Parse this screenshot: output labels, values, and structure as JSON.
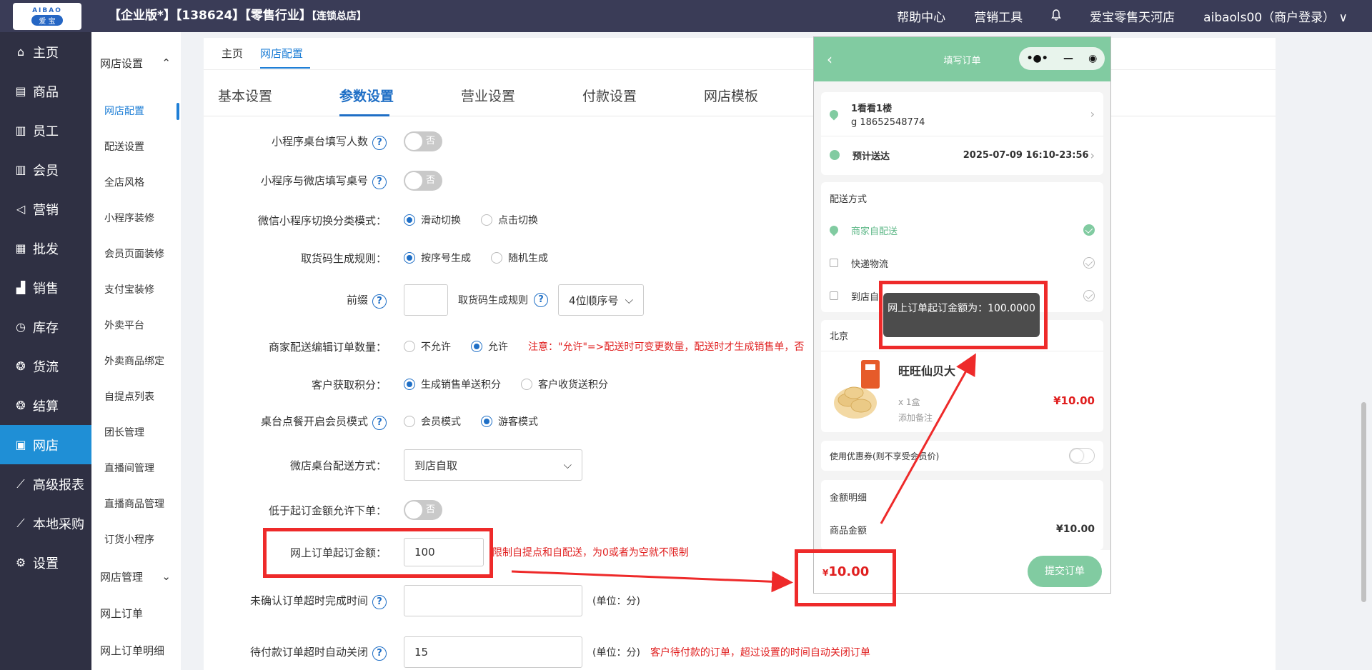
{
  "header": {
    "logo_top": "AIBAO",
    "logo_bottom": "爱 宝",
    "company": "【企业版*】【138624】【零售行业】",
    "company_small": "【连锁总店】",
    "nav": [
      "帮助中心",
      "营销工具"
    ],
    "store": "爱宝零售天河店",
    "user": "aibaols00（商户登录）",
    "chevron": "∨"
  },
  "sidebar": {
    "items": [
      {
        "icon": "⌂",
        "label": "主页"
      },
      {
        "icon": "▤",
        "label": "商品"
      },
      {
        "icon": "▥",
        "label": "员工"
      },
      {
        "icon": "▥",
        "label": "会员"
      },
      {
        "icon": "◁",
        "label": "营销"
      },
      {
        "icon": "▦",
        "label": "批发"
      },
      {
        "icon": "▟",
        "label": "销售"
      },
      {
        "icon": "◷",
        "label": "库存"
      },
      {
        "icon": "❂",
        "label": "货流"
      },
      {
        "icon": "❂",
        "label": "结算"
      },
      {
        "icon": "▣",
        "label": "网店"
      },
      {
        "icon": "⟋",
        "label": "高级报表"
      },
      {
        "icon": "⟋",
        "label": "本地采购"
      },
      {
        "icon": "⚙",
        "label": "设置"
      }
    ]
  },
  "submenu": {
    "group1": "网店设置",
    "group1_arrow": "⌃",
    "items": [
      "网店配置",
      "配送设置",
      "全店风格",
      "小程序装修",
      "会员页面装修",
      "支付宝装修",
      "外卖平台",
      "外卖商品绑定",
      "自提点列表",
      "团长管理",
      "直播间管理",
      "直播商品管理",
      "订货小程序"
    ],
    "group2": "网店管理",
    "group2_arrow": "⌄",
    "plain": [
      "网上订单",
      "网上订单明细"
    ]
  },
  "tabs1": [
    "主页",
    "网店配置"
  ],
  "tabs2": [
    "基本设置",
    "参数设置",
    "营业设置",
    "付款设置",
    "网店模板"
  ],
  "form": {
    "r1_label": "小程序桌台填写人数",
    "toggle_off": "否",
    "r2_label": "小程序与微店填写桌号",
    "r3_label": "微信小程序切换分类模式：",
    "r3_opt1": "滑动切换",
    "r3_opt2": "点击切换",
    "r4_label": "取货码生成规则：",
    "r4_opt1": "按序号生成",
    "r4_opt2": "随机生成",
    "r5_label": "前缀",
    "r5_label2": "取货码生成规则",
    "r5_select": "4位顺序号",
    "r6_label": "商家配送编辑订单数量：",
    "r6_opt1": "不允许",
    "r6_opt2": "允许",
    "r6_note": "注意：\"允许\"=>配送时可变更数量，配送时才生成销售单，否",
    "r7_label": "客户获取积分：",
    "r7_opt1": "生成销售单送积分",
    "r7_opt2": "客户收货送积分",
    "r8_label": "桌台点餐开启会员模式",
    "r8_opt1": "会员模式",
    "r8_opt2": "游客模式",
    "r9_label": "微店桌台配送方式：",
    "r9_select": "到店自取",
    "r10_label": "低于起订金额允许下单：",
    "r11_label": "网上订单起订金额：",
    "r11_value": "100",
    "r11_note": "限制自提点和自配送，为0或者为空就不限制",
    "r12_label": "未确认订单超时完成时间",
    "r12_unit": "(单位：分)",
    "r13_label": "待付款订单超时自动关闭",
    "r13_value": "15",
    "r13_unit": "(单位：分)",
    "r13_note": "客户待付款的订单，超过设置的时间自动关闭订单"
  },
  "phone": {
    "title": "填写订单",
    "caps": [
      "•●•",
      "—",
      "◉"
    ],
    "address_name": "1看看1楼",
    "address_phone": "g 18652548774",
    "eta_label": "预计送达",
    "eta_value": "2025-07-09 16:10-23:56",
    "delivery_title": "配送方式",
    "delivery_opts": [
      "商家自配送",
      "快递物流",
      "到店自"
    ],
    "city": "北京",
    "product_name": "旺旺仙贝大",
    "product_qty": "x 1盒",
    "product_note": "添加备注",
    "product_price": "¥10.00",
    "coupon_label": "使用优惠券(则不享受会员价)",
    "amount_title": "金额明细",
    "goods_amount_label": "商品金额",
    "goods_amount_value": "¥10.00",
    "total_currency": "¥",
    "total": "10.00",
    "submit": "提交订单",
    "toast": "网上订单起订金额为：100.0000"
  },
  "colors": {
    "accent": "#1f6fc6",
    "annotation": "#ee2a2a",
    "mini_green": "#81cba1"
  }
}
